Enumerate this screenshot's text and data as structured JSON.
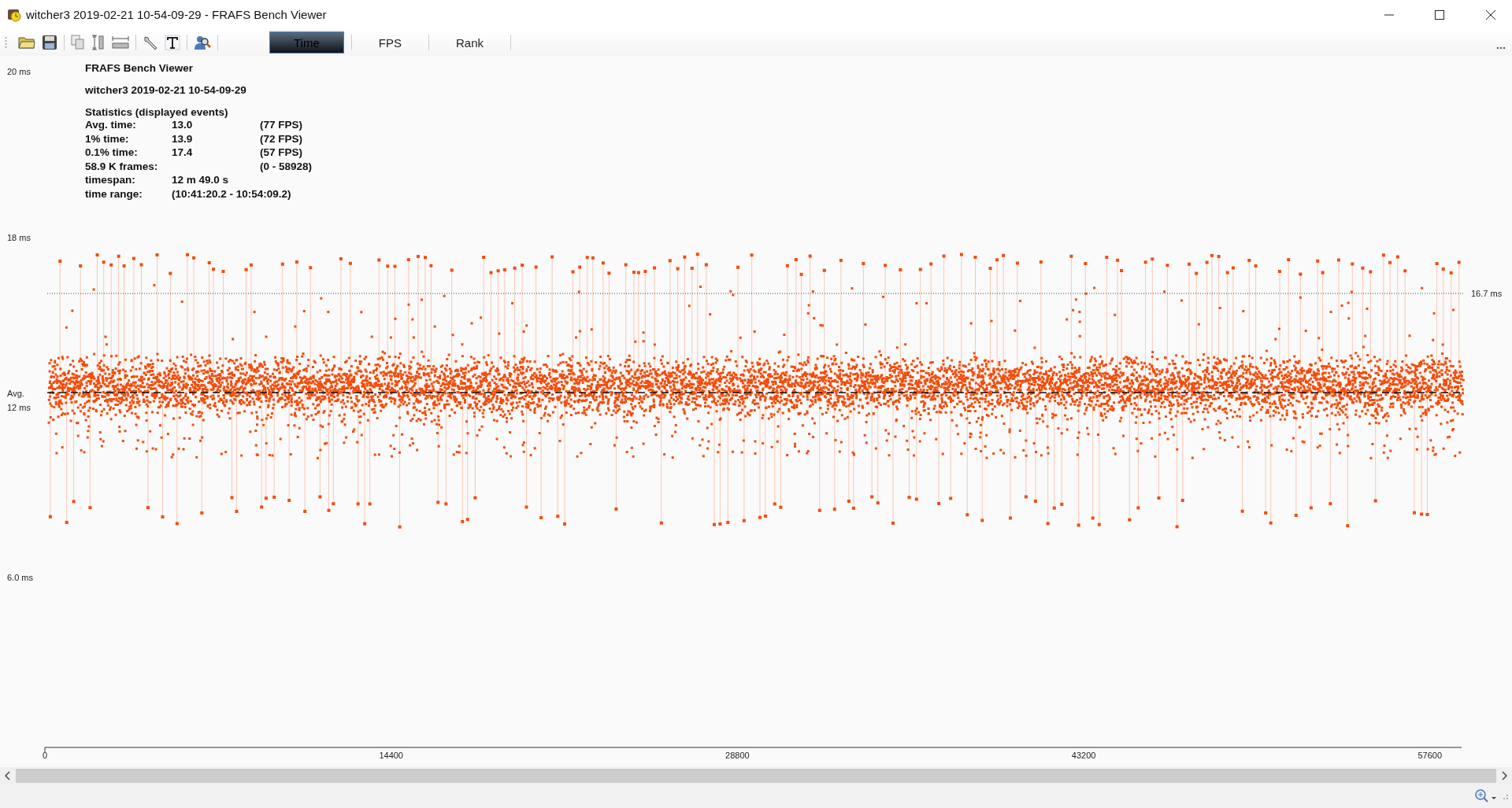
{
  "window": {
    "title": "witcher3 2019-02-21 10-54-09-29 - FRAFS Bench Viewer"
  },
  "view_tabs": [
    {
      "label": "Time",
      "selected": true
    },
    {
      "label": "FPS",
      "selected": false
    },
    {
      "label": "Rank",
      "selected": false
    }
  ],
  "plot": {
    "heading": "FRAFS Bench Viewer",
    "file": "witcher3 2019-02-21 10-54-09-29",
    "stats_title": "Statistics (displayed events)",
    "stats": [
      {
        "label": "Avg. time:",
        "value": "13.0",
        "extra": "(77 FPS)"
      },
      {
        "label": "1% time:",
        "value": "13.9",
        "extra": "(72 FPS)"
      },
      {
        "label": "0.1% time:",
        "value": "17.4",
        "extra": "(57 FPS)"
      },
      {
        "label": "58.9 K frames:",
        "extra": "(0 - 58928)"
      },
      {
        "label": "timespan:",
        "value": "12 m 49.0 s"
      },
      {
        "label": "time range:",
        "value": "(10:41:20.2 - 10:54:09.2)"
      }
    ],
    "y_labels": [
      "20 ms",
      "18 ms",
      "Avg.",
      "12 ms",
      "6.0 ms"
    ],
    "reference_label": "16.7 ms",
    "x_labels": [
      "0",
      "14400",
      "28800",
      "43200",
      "57600"
    ]
  }
}
